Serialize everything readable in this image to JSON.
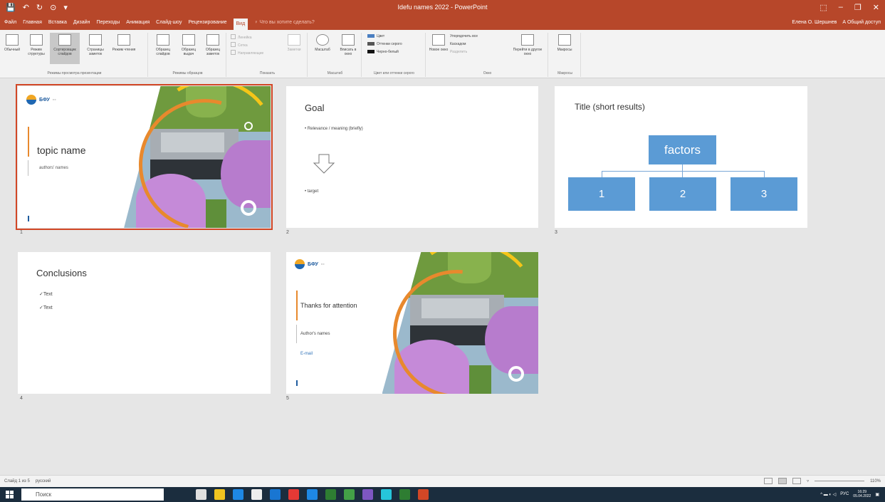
{
  "window": {
    "title": "Idefu names 2022 - PowerPoint",
    "quick_access": [
      "💾",
      "↶",
      "↻",
      "⊙",
      "▾"
    ],
    "controls": [
      "⬚",
      "–",
      "❐",
      "✕"
    ]
  },
  "ribbon_tabs": [
    "Файл",
    "Главная",
    "Вставка",
    "Дизайн",
    "Переходы",
    "Анимация",
    "Слайд-шоу",
    "Рецензирование",
    "Вид"
  ],
  "tell_me": "♀ Что вы хотите сделать?",
  "user": {
    "name": "Елена О. Шершнев",
    "share": "А Общий доступ"
  },
  "ribbon": {
    "group1": {
      "label": "Режимы просмотра презентации",
      "buttons": [
        "Обычный",
        "Режим структуры",
        "Сортировщик слайдов",
        "Страницы заметок",
        "Режим чтения"
      ]
    },
    "group2": {
      "label": "Режимы образцов",
      "buttons": [
        "Образец слайдов",
        "Образец выдач",
        "Образец заметок"
      ]
    },
    "group3": {
      "label": "Показать",
      "checks": [
        "Линейка",
        "Сетка",
        "Направляющие"
      ],
      "button": "Заметки"
    },
    "group4": {
      "label": "Масштаб",
      "buttons": [
        "Масштаб",
        "Вписать в окно"
      ]
    },
    "group5": {
      "label": "Цвет или оттенки серого",
      "options": [
        "Цвет",
        "Оттенки серого",
        "Черно-белый"
      ]
    },
    "group6": {
      "label": "Окно",
      "new_window": "Новое окно",
      "options": [
        "Упорядочить все",
        "Каскадом",
        "Разделить"
      ],
      "switch": "Перейти в другое окно"
    },
    "group7": {
      "label": "Макросы",
      "button": "Макросы"
    }
  },
  "slides": [
    {
      "number": "1",
      "title": "topic name",
      "subtitle": "authors' names",
      "logo": "БФУ"
    },
    {
      "number": "2",
      "title": "Goal",
      "bullet1": "• Relevance / meaning (briefly)",
      "bullet2": "• target"
    },
    {
      "number": "3",
      "title": "Title (short results)",
      "top": "factors",
      "boxes": [
        "1",
        "2",
        "3"
      ]
    },
    {
      "number": "4",
      "title": "Conclusions",
      "items": [
        "✓Text",
        "✓Text"
      ]
    },
    {
      "number": "5",
      "title": "Thanks for attention",
      "subtitle": "Author's names",
      "email": "E-mail",
      "logo": "БФУ"
    }
  ],
  "status": {
    "slide": "Слайд 1 из 5",
    "lang": "русский",
    "zoom": "110%"
  },
  "taskbar": {
    "search": "Поиск",
    "lang": "РУС",
    "time": "16:29",
    "date": "05.04.2022",
    "app_colors": [
      "#e0e0e0",
      "#f0c420",
      "#1e88e5",
      "#eeeeee",
      "#1976d2",
      "#e53935",
      "#1e88e5",
      "#2e7d32",
      "#43a047",
      "#7e57c2",
      "#26c6da",
      "#2e7d32",
      "#d24726"
    ]
  }
}
